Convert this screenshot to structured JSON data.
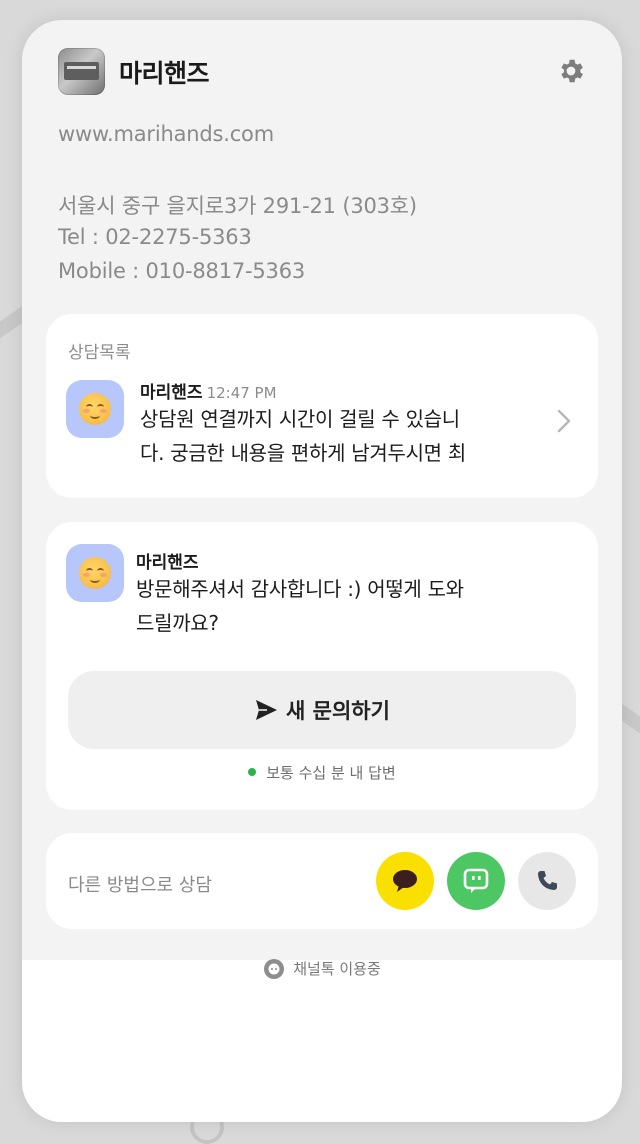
{
  "header": {
    "brand_name": "마리핸즈",
    "settings_icon": "gear-icon"
  },
  "info": {
    "website": "www.marihands.com",
    "address": "서울시 중구 을지로3가 291-21 (303호)",
    "tel": "Tel : 02-2275-5363",
    "mobile": "Mobile : 010-8817-5363"
  },
  "consult_list": {
    "title": "상담목록",
    "item": {
      "sender": "마리핸즈",
      "time": "12:47 PM",
      "line1": "상담원 연결까지 시간이 걸릴 수 있습니",
      "line2": "다. 궁금한 내용을 편하게 남겨두시면 최"
    }
  },
  "greeting": {
    "sender": "마리핸즈",
    "line1": "방문해주셔서 감사합니다 :) 어떻게 도와",
    "line2": "드릴까요?",
    "button_label": "새 문의하기",
    "status_text": "보통 수십 분 내 답변"
  },
  "other_methods": {
    "label": "다른 방법으로 상담",
    "buttons": [
      {
        "name": "kakaotalk",
        "icon": "speech-bubble-icon",
        "color": "#f9e000"
      },
      {
        "name": "naver-talk",
        "icon": "chat-icon",
        "color": "#4cc764"
      },
      {
        "name": "phone",
        "icon": "phone-icon",
        "color": "#e7e7e8"
      }
    ]
  },
  "footer": {
    "text": "채널톡 이용중"
  },
  "colors": {
    "accent_green": "#2eb34a",
    "avatar_bg": "#b7c6fb",
    "panel_bg": "#f3f3f4"
  }
}
